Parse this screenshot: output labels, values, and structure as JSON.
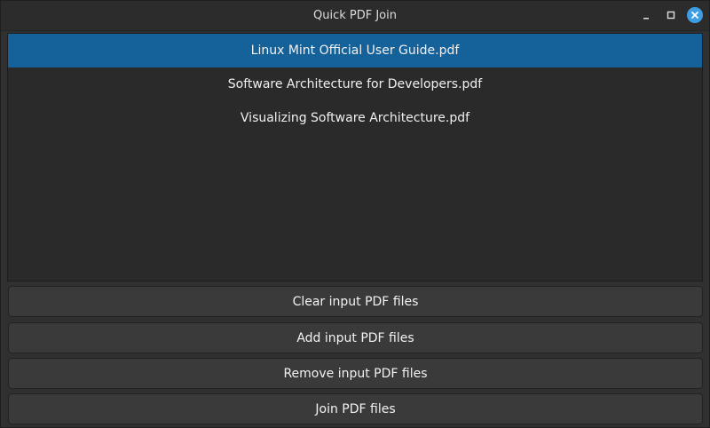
{
  "window": {
    "title": "Quick PDF Join",
    "controls": {
      "minimize_icon": "minimize-icon",
      "maximize_icon": "maximize-icon",
      "close_icon": "close-icon",
      "close_color": "#3d9ee5"
    }
  },
  "file_list": {
    "items": [
      {
        "label": "Linux Mint Official User Guide.pdf",
        "selected": true
      },
      {
        "label": "Software Architecture for Developers.pdf",
        "selected": false
      },
      {
        "label": "Visualizing Software Architecture.pdf",
        "selected": false
      }
    ],
    "selection_color": "#15629b"
  },
  "buttons": {
    "clear_label": "Clear input PDF files",
    "add_label": "Add input PDF files",
    "remove_label": "Remove input PDF files",
    "join_label": "Join PDF files"
  }
}
